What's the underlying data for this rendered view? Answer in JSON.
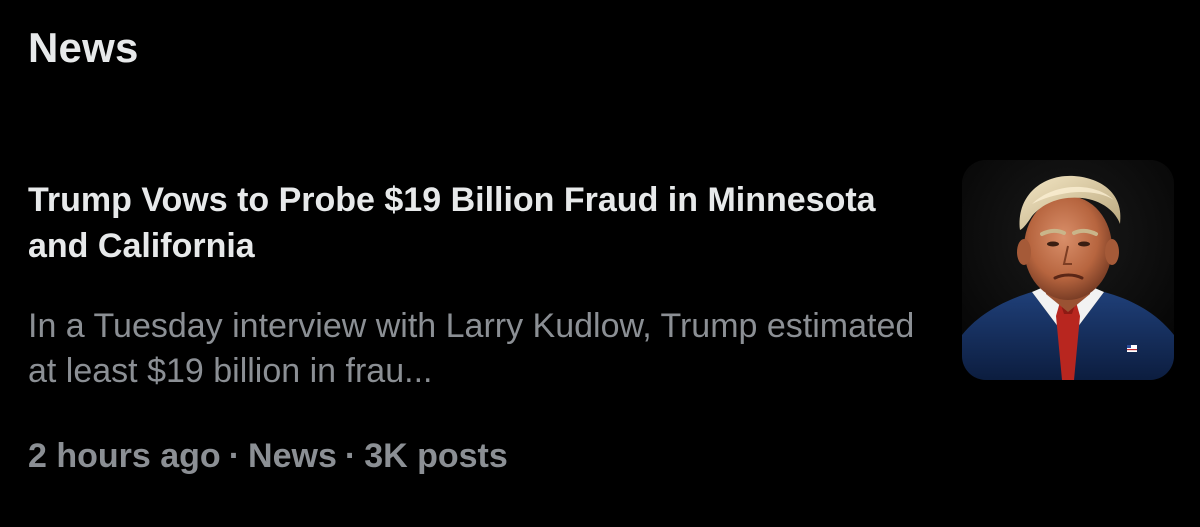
{
  "section": {
    "title": "News"
  },
  "article": {
    "headline": "Trump Vows to Probe $19 Billion Fraud in Minnesota and California",
    "summary": "In a Tuesday interview with Larry Kudlow, Trump estimated at least $19 billion in frau...",
    "meta": {
      "time": "2 hours ago",
      "category": "News",
      "posts": "3K posts",
      "separator": "·"
    },
    "thumbnail": {
      "icon": "portrait-photo"
    }
  },
  "colors": {
    "background": "#000000",
    "primary_text": "#e7e9ea",
    "secondary_text": "#8b8f94"
  }
}
